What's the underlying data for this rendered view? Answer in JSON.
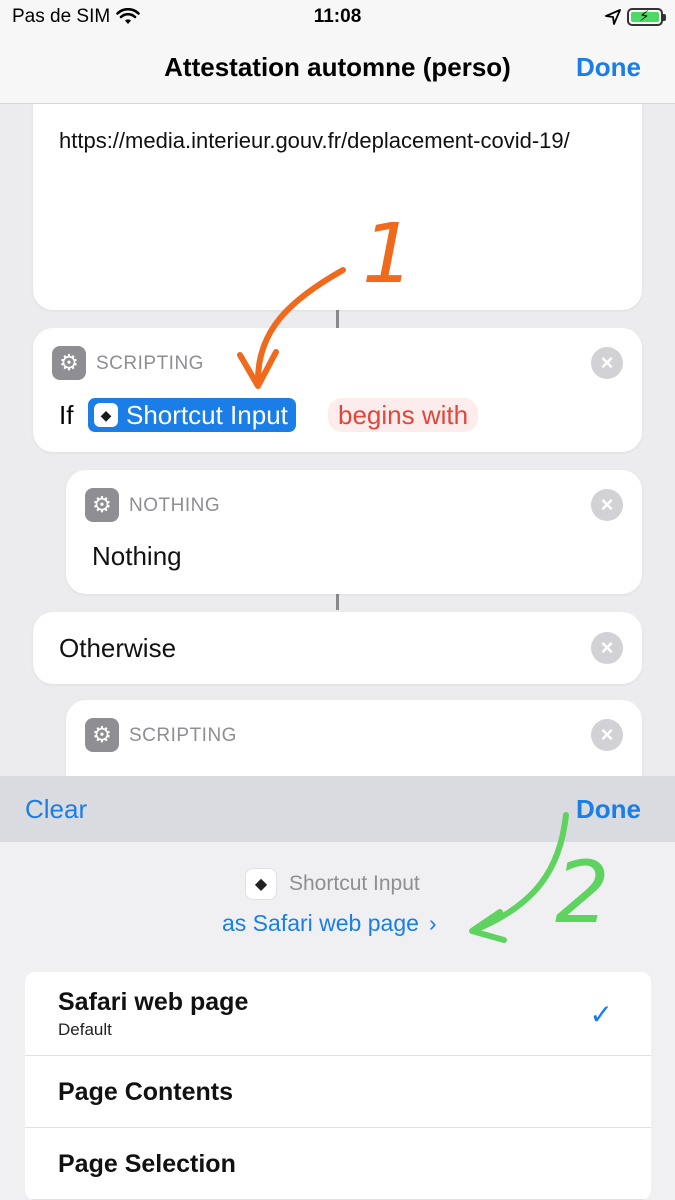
{
  "status_bar": {
    "carrier": "Pas de SIM",
    "time": "11:08"
  },
  "nav": {
    "title": "Attestation automne (perso)",
    "done_label": "Done"
  },
  "canvas": {
    "url_block": {
      "text": "https://media.interieur.gouv.fr/deplacement-covid-19/"
    },
    "if_block": {
      "category": "SCRIPTING",
      "keyword": "If",
      "variable": "Shortcut Input",
      "condition": "begins with"
    },
    "nothing_block": {
      "category": "NOTHING",
      "title": "Nothing"
    },
    "otherwise_block": {
      "title": "Otherwise"
    },
    "scripting_block": {
      "category": "SCRIPTING"
    }
  },
  "sheet": {
    "clear_label": "Clear",
    "done_label": "Done",
    "variable_name": "Shortcut Input",
    "as_type_link": "as Safari web page",
    "options": [
      {
        "title": "Safari web page",
        "subtitle": "Default",
        "selected": true
      },
      {
        "title": "Page Contents",
        "subtitle": "",
        "selected": false
      },
      {
        "title": "Page Selection",
        "subtitle": "",
        "selected": false
      }
    ]
  },
  "annotations": {
    "step1": "1",
    "step2": "2",
    "step1_color": "#f06a1e",
    "step2_color": "#5fd35f"
  },
  "colors": {
    "accent": "#1a7ee6",
    "condition_red": "#e2463a"
  },
  "icons": {
    "wifi": "wifi-icon",
    "location": "location-arrow-icon",
    "battery": "battery-charging-icon",
    "gear": "gear-icon",
    "close": "close-icon",
    "shortcuts": "shortcuts-icon",
    "chevron": "chevron-right-icon",
    "check": "checkmark-icon"
  }
}
